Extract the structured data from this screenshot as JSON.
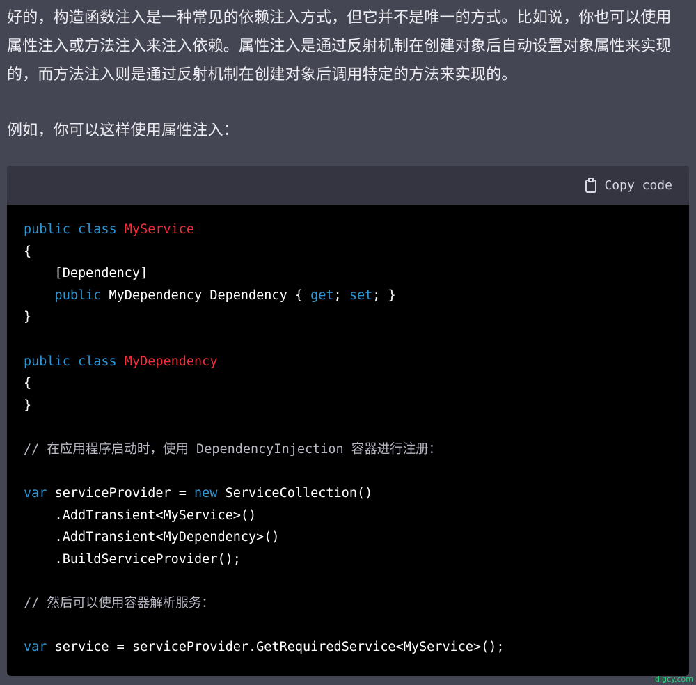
{
  "paragraphs": [
    "好的，构造函数注入是一种常见的依赖注入方式，但它并不是唯一的方式。比如说，你也可以使用属性注入或方法注入来注入依赖。属性注入是通过反射机制在创建对象后自动设置对象属性来实现的，而方法注入则是通过反射机制在创建对象后调用特定的方法来实现的。",
    "例如，你可以这样使用属性注入："
  ],
  "code_block": {
    "copy_label": "Copy code",
    "lines": [
      [
        {
          "t": "kw",
          "v": "public class "
        },
        {
          "t": "ty",
          "v": "MyService"
        }
      ],
      [
        {
          "t": "",
          "v": "{"
        }
      ],
      [
        {
          "t": "",
          "v": "    [Dependency]"
        }
      ],
      [
        {
          "t": "kw",
          "v": "    public "
        },
        {
          "t": "",
          "v": "MyDependency Dependency { "
        },
        {
          "t": "kw",
          "v": "get"
        },
        {
          "t": "",
          "v": "; "
        },
        {
          "t": "kw",
          "v": "set"
        },
        {
          "t": "",
          "v": "; }"
        }
      ],
      [
        {
          "t": "",
          "v": "}"
        }
      ],
      [
        {
          "t": "",
          "v": ""
        }
      ],
      [
        {
          "t": "kw",
          "v": "public class "
        },
        {
          "t": "ty",
          "v": "MyDependency"
        }
      ],
      [
        {
          "t": "",
          "v": "{"
        }
      ],
      [
        {
          "t": "",
          "v": "}"
        }
      ],
      [
        {
          "t": "",
          "v": ""
        }
      ],
      [
        {
          "t": "cm",
          "v": "// 在应用程序启动时，使用 DependencyInjection 容器进行注册："
        }
      ],
      [
        {
          "t": "",
          "v": ""
        }
      ],
      [
        {
          "t": "kw",
          "v": "var "
        },
        {
          "t": "",
          "v": "serviceProvider = "
        },
        {
          "t": "kw",
          "v": "new "
        },
        {
          "t": "",
          "v": "ServiceCollection()"
        }
      ],
      [
        {
          "t": "",
          "v": "    .AddTransient<MyService>()"
        }
      ],
      [
        {
          "t": "",
          "v": "    .AddTransient<MyDependency>()"
        }
      ],
      [
        {
          "t": "",
          "v": "    .BuildServiceProvider();"
        }
      ],
      [
        {
          "t": "",
          "v": ""
        }
      ],
      [
        {
          "t": "cm",
          "v": "// 然后可以使用容器解析服务："
        }
      ],
      [
        {
          "t": "",
          "v": ""
        }
      ],
      [
        {
          "t": "kw",
          "v": "var "
        },
        {
          "t": "",
          "v": "service = serviceProvider.GetRequiredService<MyService>();"
        }
      ]
    ]
  },
  "watermark": "dlgcy.com",
  "colors": {
    "page_bg": "#444654",
    "code_header_bg": "#343541",
    "code_bg": "#000000",
    "keyword": "#2e95d3",
    "type_name": "#f22c3d",
    "comment": "#b9b9c6"
  }
}
